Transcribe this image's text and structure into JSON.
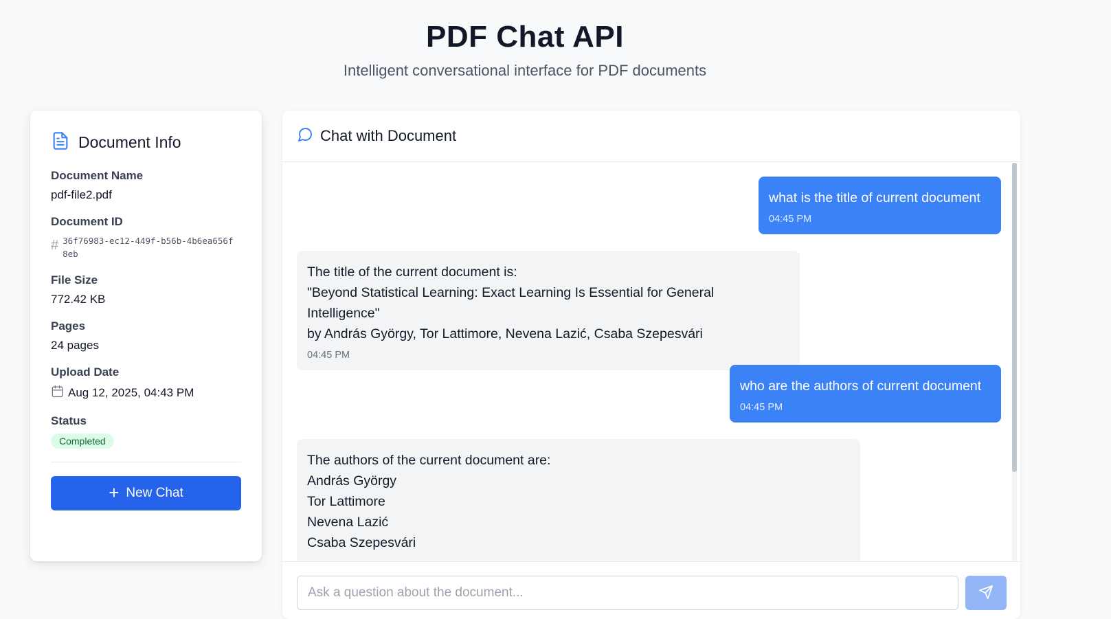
{
  "header": {
    "title": "PDF Chat API",
    "subtitle": "Intelligent conversational interface for PDF documents"
  },
  "doc_info": {
    "title": "Document Info",
    "fields": {
      "name_label": "Document Name",
      "name_value": "pdf-file2.pdf",
      "id_label": "Document ID",
      "id_value": "36f76983-ec12-449f-b56b-4b6ea656f8eb",
      "size_label": "File Size",
      "size_value": "772.42 KB",
      "pages_label": "Pages",
      "pages_value": "24 pages",
      "date_label": "Upload Date",
      "date_value": "Aug 12, 2025, 04:43 PM",
      "status_label": "Status",
      "status_value": "Completed"
    },
    "new_chat_label": "New Chat"
  },
  "chat": {
    "title": "Chat with Document",
    "messages": [
      {
        "role": "user",
        "text": "what is the title of current document",
        "time": "04:45 PM"
      },
      {
        "role": "assistant",
        "text": "The title of the current document is:\n\"Beyond Statistical Learning: Exact Learning Is Essential for General Intelligence\"\nby András György, Tor Lattimore, Nevena Lazić, Csaba Szepesvári",
        "time": "04:45 PM"
      },
      {
        "role": "user",
        "text": "who are the authors of current document",
        "time": "04:45 PM"
      },
      {
        "role": "assistant",
        "text": "The authors of the current document are:\nAndrás György\nTor Lattimore\nNevena Lazić\nCsaba Szepesvári",
        "time": ""
      }
    ],
    "input_placeholder": "Ask a question about the document...",
    "input_value": ""
  },
  "icons": {
    "doc_info": "file-text-icon",
    "id": "hash-icon",
    "date": "calendar-icon",
    "new_chat": "plus-icon",
    "chat": "message-circle-icon",
    "send": "send-icon"
  },
  "colors": {
    "primary": "#2563eb",
    "user_bubble": "#3b82f6",
    "assistant_bubble": "#f3f4f6",
    "status_bg": "#dcfce7",
    "status_text": "#166534",
    "send_disabled": "#93b4f7"
  }
}
